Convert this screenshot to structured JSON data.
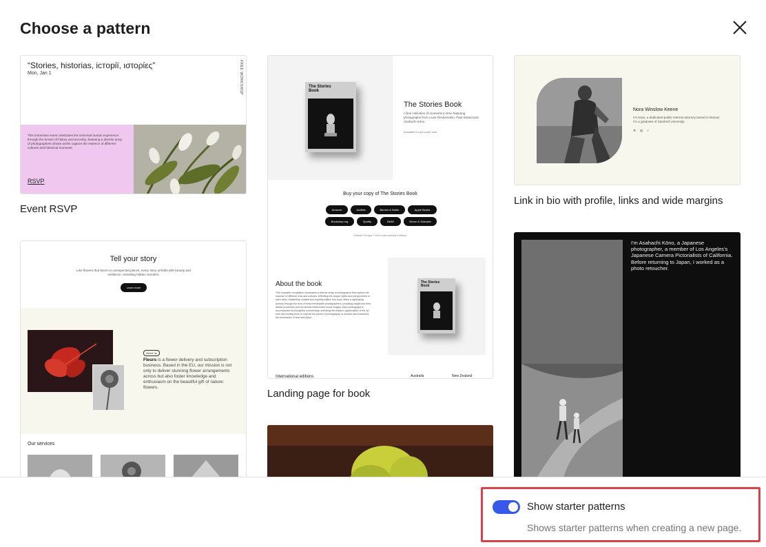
{
  "modal": {
    "title": "Choose a pattern",
    "close_icon": "close-icon"
  },
  "patterns": {
    "event_rsvp": {
      "label": "Event RSVP",
      "preview": {
        "title": "“Stories, historias, історії, ιστορίες”",
        "date": "Mon, Jan 1",
        "vertical_text": "FREE WORKSHOP",
        "description": "This immersive event celebrates the universal human experience through the lenses of history and ancestry, featuring a diverse array of photographers whose works capture the essence of different cultures and historical moments.",
        "link": "RSVP"
      }
    },
    "landing_book": {
      "label": "Landing page for book",
      "preview": {
        "cover_title": "The Stories Book",
        "hero_title": "The Stories Book",
        "hero_description": "A fine collection of moments in time featuring photographs from Louis Fleckenstein, Paul Strand and Asahachi Kōno.",
        "hero_small": "Available for pre-order now.",
        "buy_title": "Buy your copy of The Stories Book",
        "stores": [
          "Amazon",
          "Audible",
          "Barnes & Noble",
          "Apple Books",
          "Bookshop.org",
          "Spotify",
          "BAM!",
          "Simon & Schuster"
        ],
        "outside_text": "Outside Europe? View international editions.",
        "about_title": "About the book",
        "about_text": "This exquisite compilation showcases a diverse array of photographs that capture the essence of different eras and cultures, reflecting the unique styles and perspectives of each artist. Masterfully curated and expertly edited, this book offers a captivating journey through the lens of these remarkable photographers, providing insight into their artistic processes and the stories behind their iconic images. Each photograph is accompanied by thoughtful commentary, enriching the reader's appreciation of the art form and inviting them to explore the power of photography to connect and transcend the boundaries of time and place.",
        "intl_title": "International editions",
        "countries": [
          "Australia",
          "New Zealand"
        ]
      }
    },
    "link_in_bio": {
      "label": "Link in bio with profile, links and wide margins",
      "preview": {
        "name": "Nora Winslow Keene",
        "description": "I'm Nora, a dedicated public interest attorney based in Denver. I'm a graduate of Stanford University.",
        "social_icons": [
          "x-icon",
          "instagram-icon",
          "whatsapp-icon"
        ]
      }
    },
    "tell_your_story": {
      "preview": {
        "title": "Tell your story",
        "subtitle": "Like flowers that bloom in unexpected places, every story unfolds with beauty and resilience, revealing hidden wonders.",
        "button": "Learn more",
        "tag": "About us",
        "text_bold": "Fleurs",
        "text": " is a flower delivery and subscription business. Based in the EU, our mission is not only to deliver stunning flower arrangements across but also foster knowledge and enthusiasm on the beautiful gift of nature: flowers.",
        "services_title": "Our services"
      }
    },
    "photographer": {
      "preview": {
        "text": "I'm Asahachi Kōno, a Japanese photographer, a member of Los Angeles's Japanese Camera Pictorialists of California. Before returning to Japan, I worked as a photo retoucher."
      }
    }
  },
  "footer": {
    "toggle_label": "Show starter patterns",
    "toggle_help": "Shows starter patterns when creating a new page.",
    "toggle_on": true,
    "accent_color": "#3858e9",
    "highlight_color": "#d9424a"
  }
}
